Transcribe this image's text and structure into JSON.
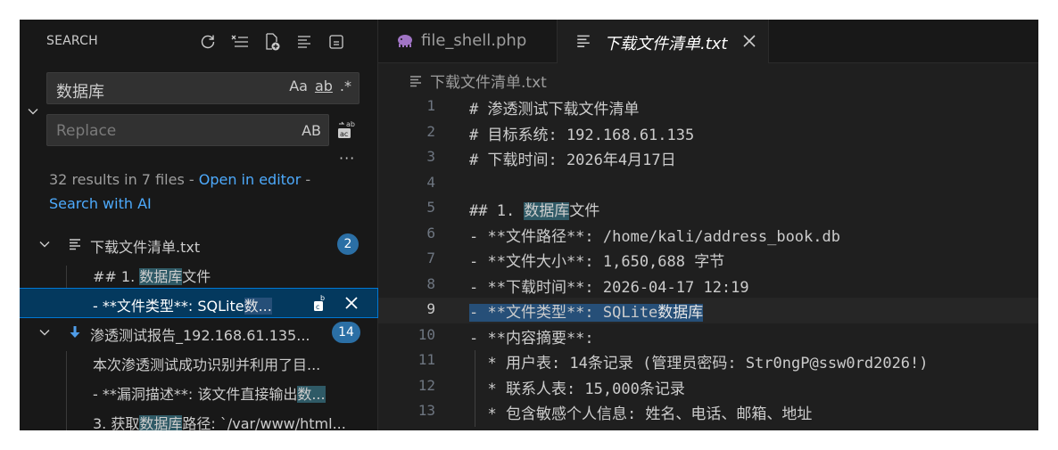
{
  "sidebar": {
    "header": "SEARCH",
    "search": {
      "value": "数据库",
      "opt_case": "Aa",
      "opt_word": "ab",
      "opt_regex": ".*"
    },
    "replace": {
      "placeholder": "Replace",
      "preserve_case": "AB"
    },
    "more": "···",
    "summary": {
      "prefix": "32 results in 7 files - ",
      "open_link": "Open in editor",
      "sep": " -",
      "ai_link": "Search with AI"
    },
    "files": [
      {
        "name": "下载文件清单.txt",
        "count": "2",
        "matches": [
          {
            "pre": "## 1. ",
            "hit": "数据库",
            "post": "文件"
          },
          {
            "pre": "- **文件类型**: SQLite",
            "hit": "数...",
            "post": ""
          }
        ]
      },
      {
        "name": "渗透测试报告_192.168.61.135...",
        "count": "14",
        "matches": [
          {
            "pre": "本次渗透测试成功识别并利用了目...",
            "hit": "",
            "post": ""
          },
          {
            "pre": "- **漏洞描述**: 该文件直接输出",
            "hit": "数...",
            "post": ""
          },
          {
            "pre": "3. 获取",
            "hit": "数据库",
            "post": "路径: `/var/www/html..."
          }
        ]
      }
    ]
  },
  "editor": {
    "tabs": [
      {
        "label": "file_shell.php",
        "icon": "php-elephant-icon"
      },
      {
        "label": "下载文件清单.txt",
        "icon": "text-file-icon"
      }
    ],
    "breadcrumb": "下载文件清单.txt",
    "lines": [
      {
        "n": "1",
        "pre": "# 渗透测试下载文件清单",
        "hit": "",
        "post": ""
      },
      {
        "n": "2",
        "pre": "# 目标系统: 192.168.61.135",
        "hit": "",
        "post": ""
      },
      {
        "n": "3",
        "pre": "# 下载时间: 2026年4月17日",
        "hit": "",
        "post": ""
      },
      {
        "n": "4",
        "pre": "",
        "hit": "",
        "post": ""
      },
      {
        "n": "5",
        "pre": "## 1. ",
        "hit": "数据库",
        "post": "文件"
      },
      {
        "n": "6",
        "pre": "- **文件路径**: /home/kali/address_book.db",
        "hit": "",
        "post": ""
      },
      {
        "n": "7",
        "pre": "- **文件大小**: 1,650,688 字节",
        "hit": "",
        "post": ""
      },
      {
        "n": "8",
        "pre": "- **下载时间**: 2026-04-17 12:19",
        "hit": "",
        "post": ""
      },
      {
        "n": "9",
        "pre": "- **文件类型**: SQLite",
        "hit": "数据库",
        "post": ""
      },
      {
        "n": "10",
        "pre": "- **内容摘要**:",
        "hit": "",
        "post": ""
      },
      {
        "n": "11",
        "pre": "  * 用户表: 14条记录 (管理员密码: Str0ngP@ssw0rd2026!)",
        "hit": "",
        "post": ""
      },
      {
        "n": "12",
        "pre": "  * 联系人表: 15,000条记录",
        "hit": "",
        "post": ""
      },
      {
        "n": "13",
        "pre": "  * 包含敏感个人信息: 姓名、电话、邮箱、地址",
        "hit": "",
        "post": ""
      }
    ]
  }
}
